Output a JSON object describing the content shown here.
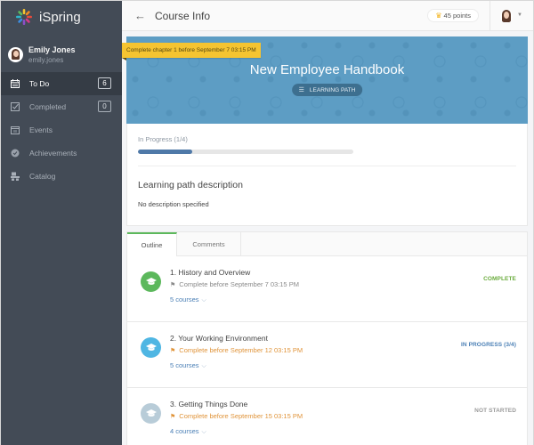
{
  "brand": {
    "name": "iSpring"
  },
  "user": {
    "name": "Emily Jones",
    "login": "emily.jones"
  },
  "sidebar": {
    "items": [
      {
        "label": "To Do",
        "icon": "calendar-icon",
        "badge": "6",
        "active": true
      },
      {
        "label": "Completed",
        "icon": "checkbox-icon",
        "badge": "0",
        "active": false
      },
      {
        "label": "Events",
        "icon": "calendar-events-icon",
        "badge": null,
        "active": false
      },
      {
        "label": "Achievements",
        "icon": "medal-icon",
        "badge": null,
        "active": false
      },
      {
        "label": "Catalog",
        "icon": "catalog-icon",
        "badge": null,
        "active": false
      }
    ]
  },
  "topbar": {
    "back_icon": "←",
    "title": "Course Info",
    "points": "45 points",
    "crown_icon": "♛",
    "caret": "▼"
  },
  "hero": {
    "deadline_ribbon": "Complete chapter 1 before September 7 03:15 PM",
    "title": "New Employee Handbook",
    "tag": "LEARNING PATH",
    "tag_icon": "☰",
    "background_color": "#5d9dc4"
  },
  "progress": {
    "label": "In Progress (1/4)",
    "completed": 1,
    "total": 4,
    "fraction": 0.25
  },
  "description": {
    "title": "Learning path description",
    "text": "No description specified"
  },
  "tabs": [
    {
      "label": "Outline",
      "active": true
    },
    {
      "label": "Comments",
      "active": false
    }
  ],
  "chapters": [
    {
      "title": "1. History and Overview",
      "deadline": "Complete before September 7 03:15 PM",
      "deadline_style": "normal",
      "courses": "5 courses",
      "status": "COMPLETE",
      "status_color": "#6aab3c",
      "icon_color": "#5cb85c"
    },
    {
      "title": "2. Your Working Environment",
      "deadline": "Complete before September 12 03:15 PM",
      "deadline_style": "warn",
      "courses": "5 courses",
      "status": "IN PROGRESS (3/4)",
      "status_color": "#4a7fb5",
      "icon_color": "#4fb6e3"
    },
    {
      "title": "3. Getting Things Done",
      "deadline": "Complete before September 15 03:15 PM",
      "deadline_style": "warn",
      "courses": "4 courses",
      "status": "NOT STARTED",
      "status_color": "#9a9a9a",
      "icon_color": "#b8ccd8"
    }
  ],
  "icons": {
    "flag": "⚑",
    "chevron_down": "⌵",
    "graduation_cap": "🎓"
  }
}
